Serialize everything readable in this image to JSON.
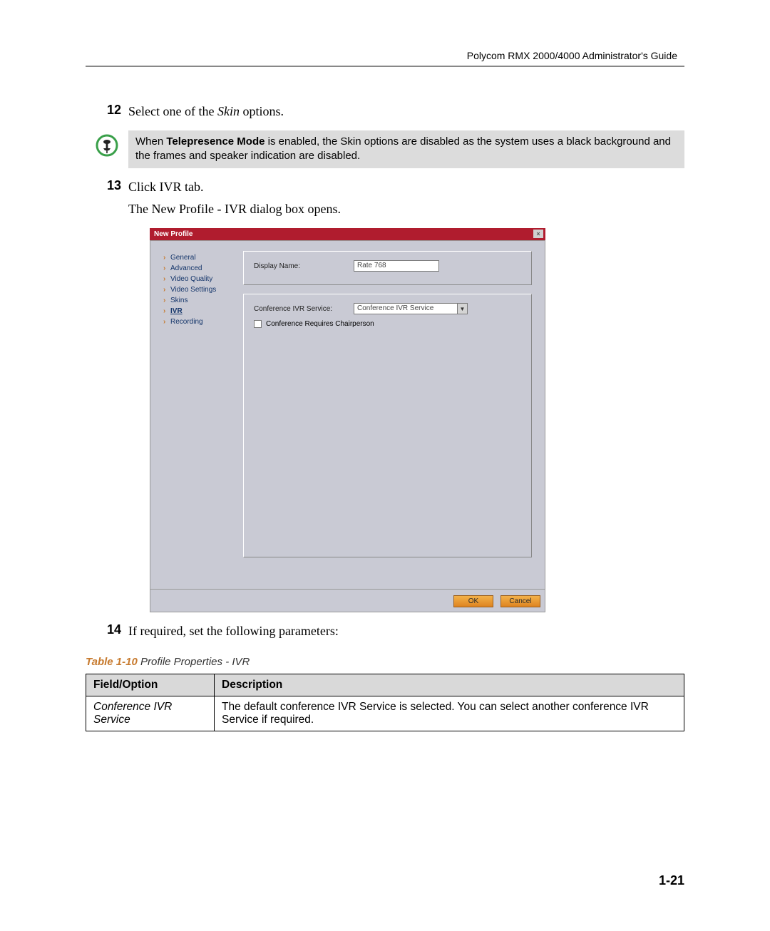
{
  "header": "Polycom RMX 2000/4000 Administrator's Guide",
  "step12": {
    "num": "12",
    "pre": "Select one of the ",
    "italic": "Skin",
    "post": " options."
  },
  "note": {
    "pre": "When ",
    "bold": "Telepresence Mode",
    "post": " is enabled, the Skin options are disabled as the system uses a black background and the frames and speaker indication are disabled."
  },
  "step13": {
    "num": "13",
    "text": "Click IVR tab."
  },
  "step13b": {
    "pre": "The ",
    "italic": "New Profile - IVR",
    "post": " dialog box opens."
  },
  "dialog": {
    "title": "New Profile",
    "close": "×",
    "sidebar": [
      "General",
      "Advanced",
      "Video Quality",
      "Video Settings",
      "Skins",
      "IVR",
      "Recording"
    ],
    "display_name_label": "Display Name:",
    "display_name_value": "Rate 768",
    "ivr_label": "Conference IVR Service:",
    "ivr_value": "Conference IVR Service",
    "chk_label": "Conference Requires Chairperson",
    "ok": "OK",
    "cancel": "Cancel"
  },
  "step14": {
    "num": "14",
    "text": "If required, set the following parameters:"
  },
  "table": {
    "caption_num": "Table 1-10",
    "caption_text": "  Profile Properties - IVR",
    "head_field": "Field/Option",
    "head_desc": "Description",
    "row_field": "Conference IVR Service",
    "row_desc": "The default conference IVR Service is selected. You can select another conference IVR Service if required."
  },
  "page_number": "1-21"
}
